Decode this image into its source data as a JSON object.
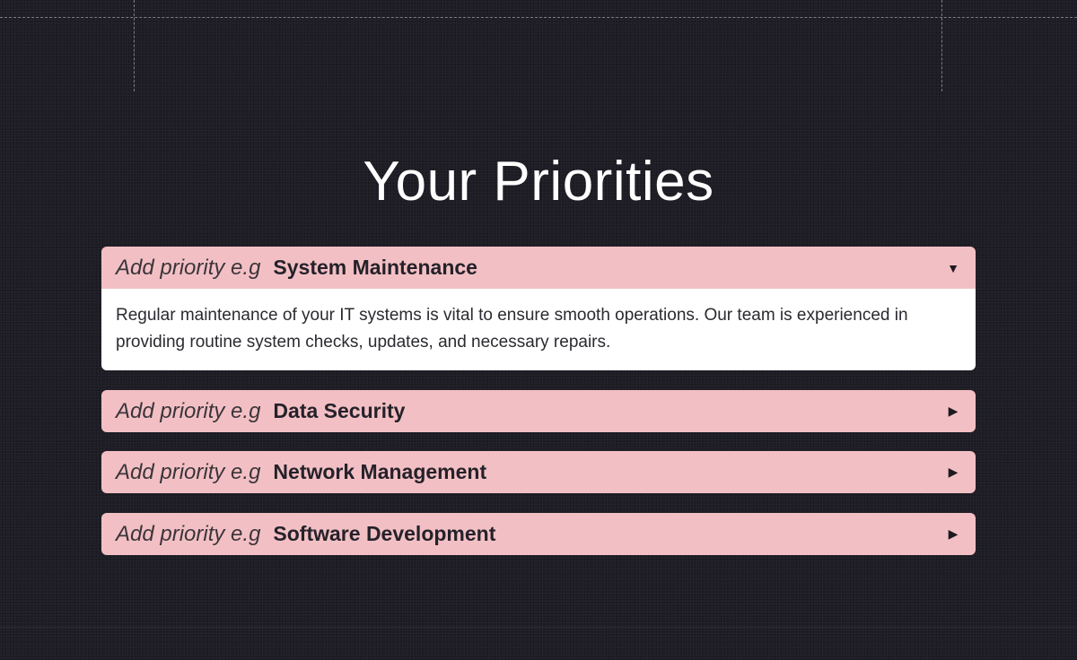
{
  "page": {
    "title": "Your Priorities"
  },
  "priorities": {
    "items": [
      {
        "prefix": "Add priority e.g",
        "title": "System Maintenance",
        "expanded": true,
        "toggle_icon": "caret-down-icon",
        "toggle_glyph": "▼",
        "description": "Regular maintenance of your IT systems is vital to ensure smooth operations. Our team is experienced in providing routine system checks, updates, and necessary repairs."
      },
      {
        "prefix": "Add priority e.g",
        "title": "Data Security",
        "expanded": false,
        "toggle_icon": "caret-right-icon",
        "toggle_glyph": "▶"
      },
      {
        "prefix": "Add priority e.g",
        "title": "Network Management",
        "expanded": false,
        "toggle_icon": "caret-right-icon",
        "toggle_glyph": "▶"
      },
      {
        "prefix": "Add priority e.g",
        "title": "Software Development",
        "expanded": false,
        "toggle_icon": "caret-right-icon",
        "toggle_glyph": "▶"
      }
    ]
  },
  "colors": {
    "background": "#1e1d25",
    "accordion_header": "#f2c0c4",
    "accordion_body": "#ffffff",
    "title_text": "#ffffff"
  }
}
